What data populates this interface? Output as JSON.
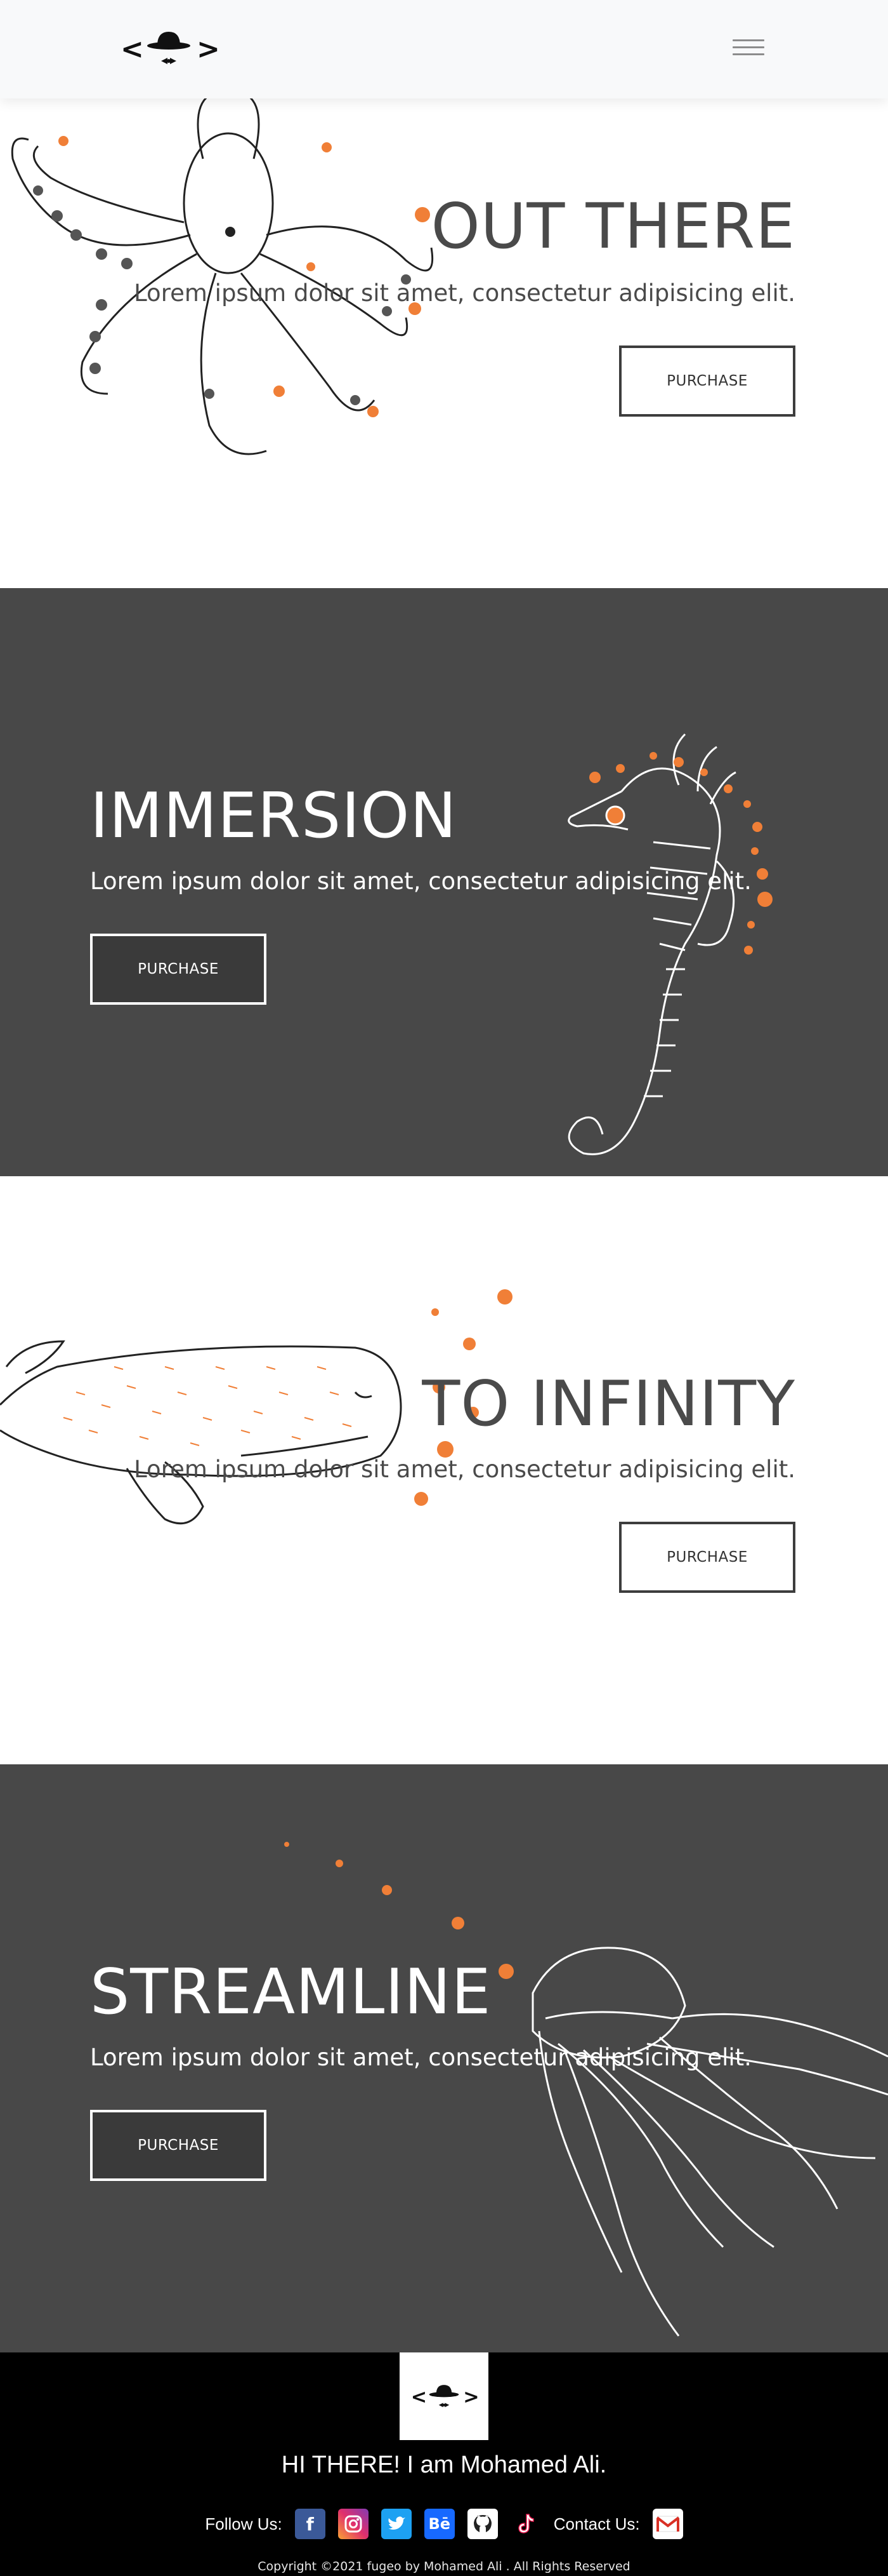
{
  "navbar": {
    "logo_icon": "hat-bowtie-logo-icon",
    "menu_icon": "hamburger-menu-icon"
  },
  "sections": [
    {
      "title": "OUT THERE",
      "subtitle": "Lorem ipsum dolor sit amet, consectetur adipisicing elit.",
      "button": "PURCHASE",
      "illustration": "octopus-illustration"
    },
    {
      "title": "IMMERSION",
      "subtitle": "Lorem ipsum dolor sit amet, consectetur adipisicing elit.",
      "button": "PURCHASE",
      "illustration": "seahorse-illustration"
    },
    {
      "title": "TO INFINITY",
      "subtitle": "Lorem ipsum dolor sit amet, consectetur adipisicing elit.",
      "button": "PURCHASE",
      "illustration": "whale-illustration"
    },
    {
      "title": "STREAMLINE",
      "subtitle": "Lorem ipsum dolor sit amet, consectetur adipisicing elit.",
      "button": "PURCHASE",
      "illustration": "jellyfish-illustration"
    }
  ],
  "footer": {
    "greeting": "HI THERE! I am Mohamed Ali.",
    "follow_label": "Follow Us:",
    "contact_label": "Contact Us:",
    "copyright": "Copyright ©2021 fugeo by Mohamed Ali . All Rights Reserved",
    "social": [
      {
        "name": "facebook-icon",
        "glyph": "f",
        "color": "#3b5998"
      },
      {
        "name": "instagram-icon",
        "glyph": "◎",
        "color": "#e1306c"
      },
      {
        "name": "twitter-icon",
        "glyph": "🐦",
        "color": "#1da1f2"
      },
      {
        "name": "behance-icon",
        "glyph": "Bē",
        "color": "#1769ff"
      },
      {
        "name": "github-icon",
        "glyph": "⌂",
        "color": "#ffffff"
      },
      {
        "name": "tiktok-icon",
        "glyph": "♪",
        "color": "#000000"
      }
    ],
    "mail_icon": "gmail-icon"
  },
  "colors": {
    "accent": "#f07f37",
    "dark_section": "#484848",
    "footer_bg": "#000000",
    "navbar_bg": "#f8f9fa"
  }
}
